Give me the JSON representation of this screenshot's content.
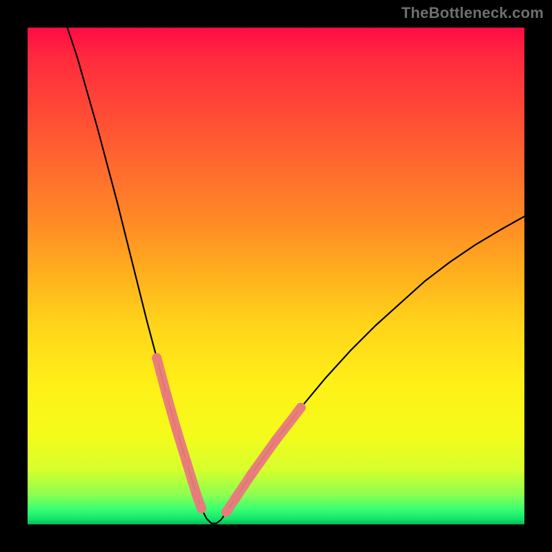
{
  "watermark": "TheBottleneck.com",
  "chart_data": {
    "type": "line",
    "title": "",
    "xlabel": "",
    "ylabel": "",
    "xlim": [
      0,
      100
    ],
    "ylim": [
      0,
      100
    ],
    "notes": "V-shaped bottleneck curve. Minimum (0%) near x≈37. Left branch rises to 100% at x≈8; right branch rises to ≈62% at x=100. Gradient background encodes y: red≈100, green≈0. Dotted coral segments near the trough mark the zero-bottleneck band.",
    "series": [
      {
        "name": "curve",
        "x": [
          8,
          10,
          12,
          14,
          16,
          18,
          20,
          22,
          24,
          26,
          28,
          30,
          32,
          34,
          35,
          36,
          37,
          38,
          39,
          40,
          42,
          45,
          50,
          55,
          60,
          65,
          70,
          75,
          80,
          85,
          90,
          95,
          100
        ],
        "y": [
          100,
          94,
          87,
          80,
          72.5,
          65,
          57,
          49,
          41,
          33.5,
          26,
          19,
          12.5,
          6,
          3.2,
          1.2,
          0.2,
          0.2,
          1,
          2.5,
          5.5,
          10,
          17,
          23.5,
          29.5,
          35,
          40,
          44.5,
          49,
          52.8,
          56.2,
          59.2,
          62
        ]
      }
    ],
    "dotted_segments": {
      "left": {
        "x": [
          26,
          28,
          30,
          32,
          34,
          35
        ],
        "y": [
          33.5,
          26,
          19,
          12.5,
          6,
          3.2
        ]
      },
      "right": {
        "x": [
          40,
          42,
          45,
          50,
          55
        ],
        "y": [
          2.5,
          5.5,
          10,
          17,
          23.5
        ]
      }
    },
    "dot_style": {
      "color": "#e97b7d",
      "radius_px_approx": 7
    }
  }
}
